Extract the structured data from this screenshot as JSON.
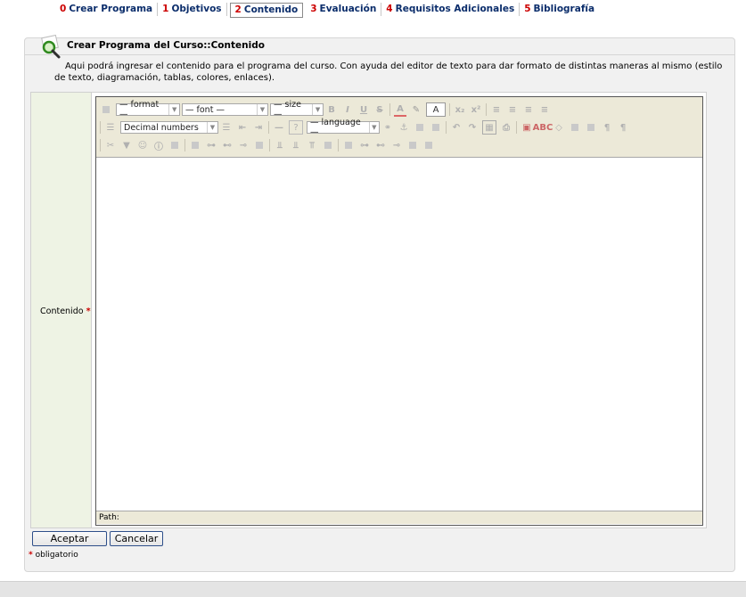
{
  "tabs": [
    {
      "num": "0",
      "label": "Crear Programa"
    },
    {
      "num": "1",
      "label": "Objetivos"
    },
    {
      "num": "2",
      "label": "Contenido"
    },
    {
      "num": "3",
      "label": "Evaluación"
    },
    {
      "num": "4",
      "label": "Requisitos Adicionales"
    },
    {
      "num": "5",
      "label": "Bibliografía"
    }
  ],
  "active_tab": "Contenido",
  "panel": {
    "title": "Crear Programa del Curso::Contenido",
    "description": "Aqui podrá ingresar el contenido para el programa del curso. Con ayuda del editor de texto para dar formato de distintas maneras al mismo (estilo de texto, diagramación, tablas, colores, enlaces)."
  },
  "form": {
    "field_label": "Contenido",
    "required_mark": "*"
  },
  "editor": {
    "format_select": "— format —",
    "font_select": "— font —",
    "size_select": "— size —",
    "list_select": "Decimal numbers",
    "language_select": "— language —",
    "help_glyph": "?",
    "path_label": "Path:"
  },
  "buttons": {
    "accept": "Aceptar",
    "cancel": "Cancelar"
  },
  "footer_note": {
    "mark": "*",
    "text": "obligatorio"
  },
  "colors": {
    "tab_number": "#cc0000",
    "tab_text": "#0b2d6b",
    "label_background": "#eef3e4",
    "toolbar_background": "#ece9d8"
  }
}
